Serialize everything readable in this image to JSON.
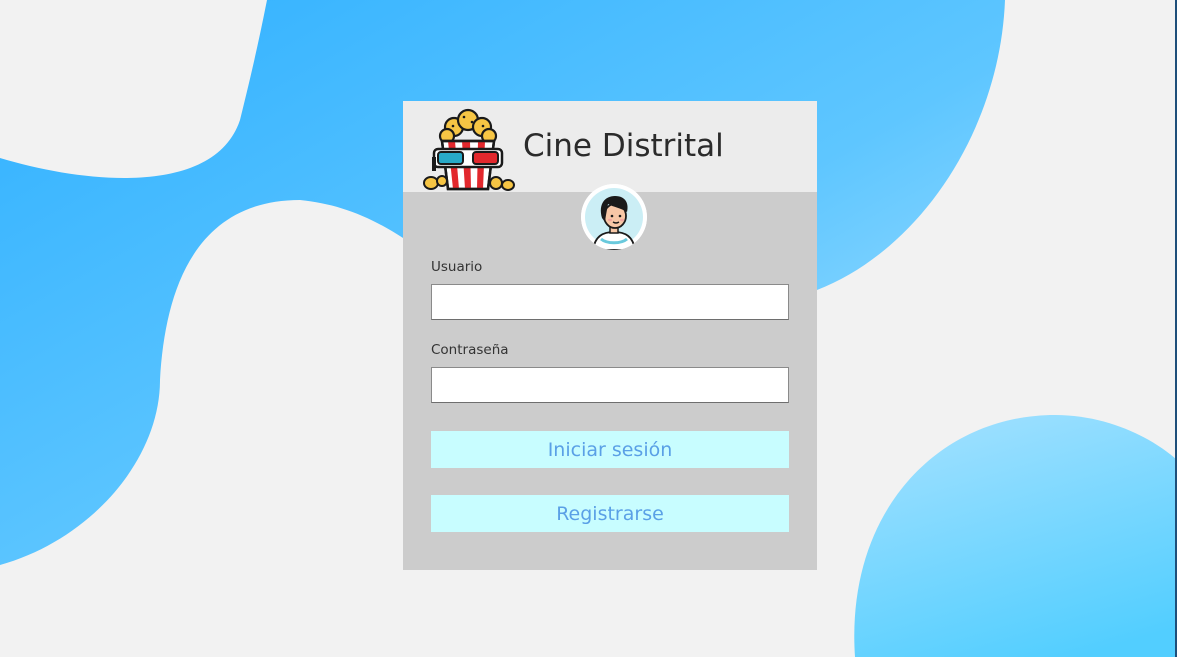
{
  "app": {
    "title": "Cine Distrital",
    "logo_icon": "popcorn-3d-glasses-icon",
    "avatar_icon": "user-avatar-icon"
  },
  "form": {
    "username_label": "Usuario",
    "username_value": "",
    "password_label": "Contraseña",
    "password_value": "",
    "login_button": "Iniciar sesión",
    "register_button": "Registrarse"
  },
  "colors": {
    "background": "#f2f2f2",
    "blob_blue": "#40b8ff",
    "blob_light": "#a8e0ff",
    "card": "#cccccc",
    "card_header": "#ececec",
    "button_bg": "#c8fdff",
    "button_text": "#5aa0e6"
  }
}
